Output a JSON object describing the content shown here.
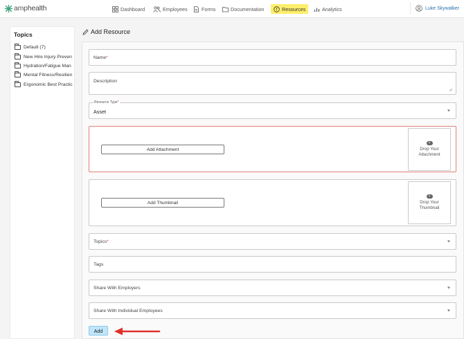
{
  "brand": {
    "name_prefix": "amp",
    "name_suffix": "health"
  },
  "nav": {
    "dashboard": "Dashboard",
    "employees": "Employees",
    "forms": "Forms",
    "documentation": "Documentation",
    "resources": "Resources",
    "analytics": "Analytics",
    "active": "resources"
  },
  "user": {
    "name": "Luke Skywalker"
  },
  "sidebar": {
    "title": "Topics",
    "items": [
      {
        "label": "Default (7)"
      },
      {
        "label": "New Hire Injury Preven"
      },
      {
        "label": "Hydration/Fatigue Man"
      },
      {
        "label": "Mental Fitness/Resilien"
      },
      {
        "label": "Ergonomic Best Practic"
      }
    ]
  },
  "form": {
    "title": "Add Resource",
    "name_label": "Name",
    "description_label": "Description",
    "resource_type_label": "Resource Type",
    "resource_type_value": "Asset",
    "add_attachment_label": "Add Attachment",
    "drop_attachment_line1": "Drop Your",
    "drop_attachment_line2": "Attachment",
    "add_thumbnail_label": "Add Thumbnail",
    "drop_thumbnail_line1": "Drop Your",
    "drop_thumbnail_line2": "Thumbnail",
    "topics_label": "Topics",
    "tags_label": "Tags",
    "share_employers_label": "Share With Employers",
    "share_employees_label": "Share With Individual Employees",
    "required_mark": "*",
    "submit_label": "Add"
  },
  "colors": {
    "accent_active_nav": "#fdee6a",
    "user_link": "#2a6fb0",
    "error_border": "#e57f74",
    "submit_bg": "#bfe6fa",
    "annotation_arrow": "#e0302a"
  }
}
